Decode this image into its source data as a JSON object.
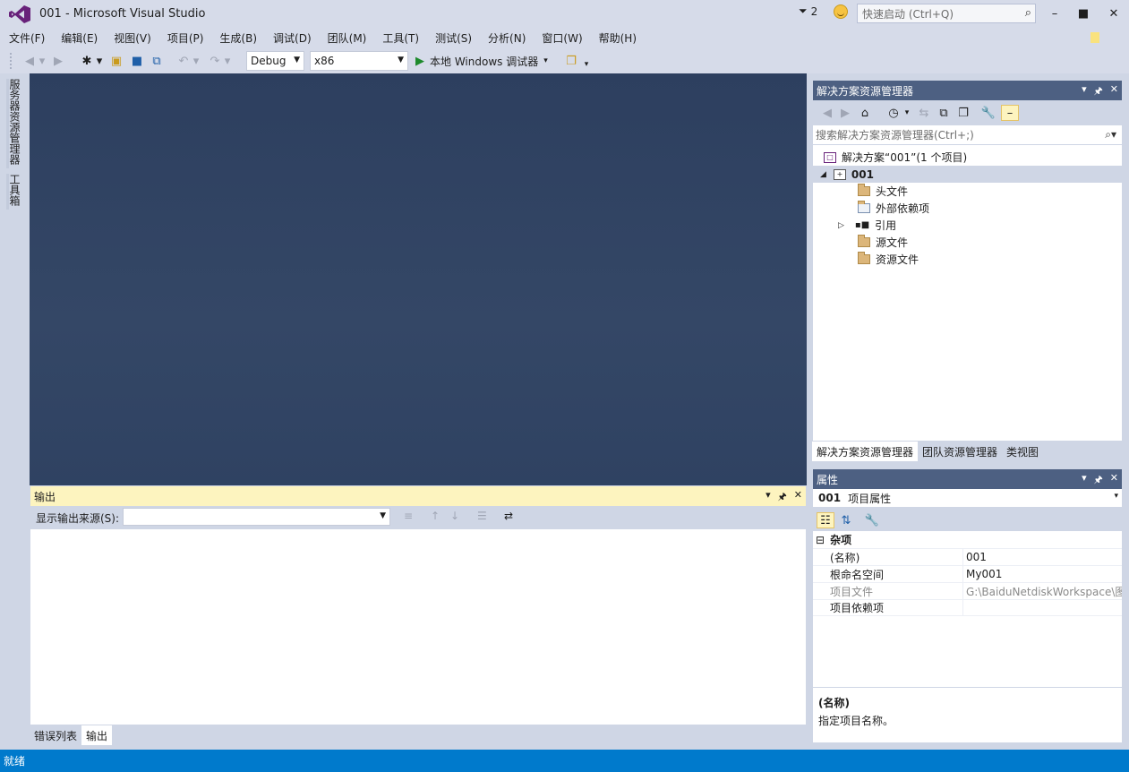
{
  "window": {
    "title": "001 - Microsoft Visual Studio",
    "notification_count": "2",
    "quick_launch_placeholder": "快速启动 (Ctrl+Q)"
  },
  "menu": [
    "文件(F)",
    "编辑(E)",
    "视图(V)",
    "项目(P)",
    "生成(B)",
    "调试(D)",
    "团队(M)",
    "工具(T)",
    "测试(S)",
    "分析(N)",
    "窗口(W)",
    "帮助(H)"
  ],
  "toolbar": {
    "configuration": "Debug",
    "platform": "x86",
    "run_label": "本地 Windows 调试器"
  },
  "left_tabs": [
    "服务器资源管理器",
    "工具箱"
  ],
  "solution_explorer": {
    "title": "解决方案资源管理器",
    "search_placeholder": "搜索解决方案资源管理器(Ctrl+;)",
    "tree": {
      "solution": "解决方案“001”(1 个项目)",
      "project": "001",
      "items": [
        "头文件",
        "外部依赖项",
        "引用",
        "源文件",
        "资源文件"
      ]
    },
    "tabs": [
      "解决方案资源管理器",
      "团队资源管理器",
      "类视图"
    ]
  },
  "properties": {
    "title": "属性",
    "object_name": "001",
    "object_type": "项目属性",
    "category": "杂项",
    "rows": [
      {
        "key": "(名称)",
        "value": "001"
      },
      {
        "key": "根命名空间",
        "value": "My001"
      },
      {
        "key": "项目文件",
        "value": "G:\\BaiduNetdiskWorkspace\\图"
      },
      {
        "key": "项目依赖项",
        "value": ""
      }
    ],
    "desc_title": "(名称)",
    "desc_text": "指定项目名称。"
  },
  "output": {
    "title": "输出",
    "source_label": "显示输出来源(S):",
    "source_value": "",
    "tabs": [
      "错误列表",
      "输出"
    ]
  },
  "status": {
    "text": "就绪"
  },
  "colors": {
    "chrome": "#d6dbe9",
    "panel_header_active": "#fdf4bf",
    "panel_header": "#4d6082",
    "editor_bg": "#2d3f5f",
    "statusbar": "#007acc",
    "vs_purple": "#68217a"
  }
}
